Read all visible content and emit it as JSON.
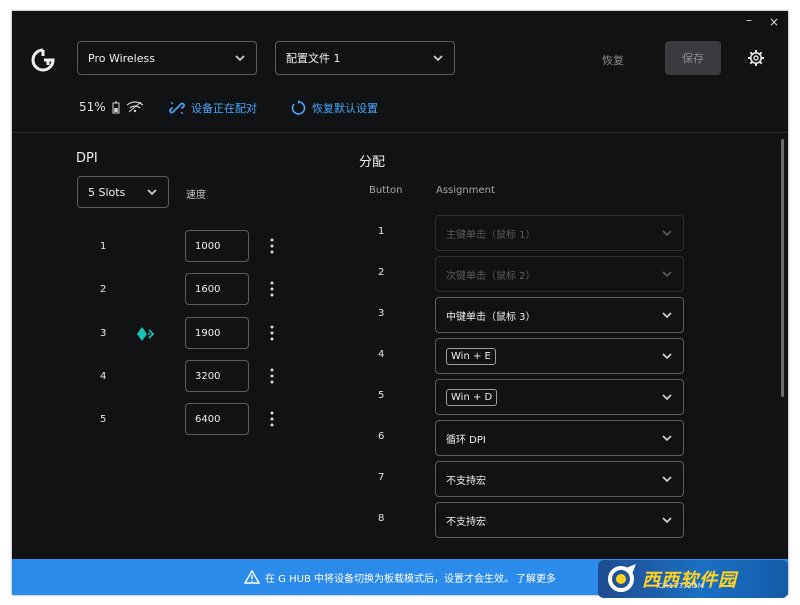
{
  "window": {
    "minimize_glyph": "–",
    "close_glyph": "×"
  },
  "header": {
    "logo_icon": "logitech-g-logo-icon",
    "device_select": {
      "value": "Pro Wireless",
      "icon": "chevron-down-icon"
    },
    "profile_select": {
      "value": "配置文件 1",
      "icon": "chevron-down-icon"
    },
    "restore_label": "恢复",
    "save_label": "保存",
    "settings_icon": "gear-icon"
  },
  "status": {
    "battery_percent": "51%",
    "battery_icon": "battery-icon",
    "wireless_icon": "wireless-signal-icon",
    "pairing_label": "设备正在配对",
    "pairing_icon": "link-broken-icon",
    "reset_defaults_label": "恢复默认设置",
    "reset_icon": "reset-icon"
  },
  "dpi": {
    "title": "DPI",
    "slots_select": "5 Slots",
    "speed_label": "速度",
    "active_slot": 3,
    "rows": [
      {
        "index": "1",
        "value": "1000"
      },
      {
        "index": "2",
        "value": "1600"
      },
      {
        "index": "3",
        "value": "1900"
      },
      {
        "index": "4",
        "value": "3200"
      },
      {
        "index": "5",
        "value": "6400"
      }
    ]
  },
  "assignments": {
    "title": "分配",
    "col_button": "Button",
    "col_assignment": "Assignment",
    "rows": [
      {
        "button": "1",
        "assignment": "主键单击（鼠标 1）",
        "disabled": true,
        "chip": false
      },
      {
        "button": "2",
        "assignment": "次键单击（鼠标 2）",
        "disabled": true,
        "chip": false
      },
      {
        "button": "3",
        "assignment": "中键单击（鼠标 3）",
        "disabled": false,
        "chip": false
      },
      {
        "button": "4",
        "assignment": "Win + E",
        "disabled": false,
        "chip": true
      },
      {
        "button": "5",
        "assignment": "Win + D",
        "disabled": false,
        "chip": true
      },
      {
        "button": "6",
        "assignment": "循环 DPI",
        "disabled": false,
        "chip": false
      },
      {
        "button": "7",
        "assignment": "不支持宏",
        "disabled": false,
        "chip": false
      },
      {
        "button": "8",
        "assignment": "不支持宏",
        "disabled": false,
        "chip": false
      }
    ]
  },
  "banner": {
    "icon": "warning-icon",
    "message": "在 G HUB 中将设备切换为板载模式后，设置才会生效。",
    "link": "了解更多"
  },
  "watermark": {
    "text": "西西软件园",
    "sub": "CR173.COM"
  },
  "colors": {
    "background": "#111214",
    "accent_blue": "#4aa6ff",
    "banner_blue": "#2a8bea",
    "active_teal": "#19c4b4"
  }
}
